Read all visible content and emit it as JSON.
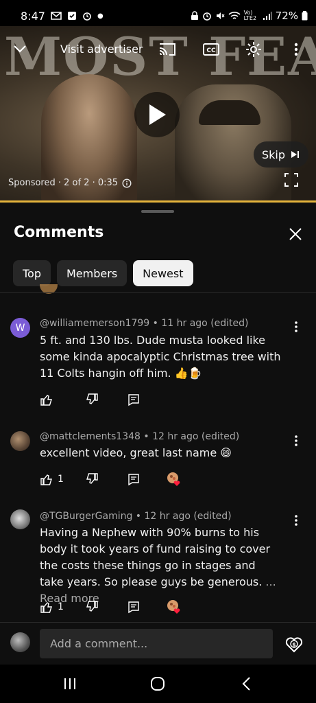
{
  "status_bar": {
    "time": "8:47",
    "left_icons": [
      "gmail-icon",
      "check-icon",
      "alarm-icon",
      "dot-icon"
    ],
    "right_icons": [
      "lock-icon",
      "alarm-icon",
      "mute-icon",
      "wifi-icon",
      "signal-icon"
    ],
    "network": "Vo) LTE2",
    "battery": "72%"
  },
  "video": {
    "background_title": "MOST FEARED",
    "visit_advertiser": "Visit advertiser",
    "skip_label": "Skip",
    "sponsored_text": "Sponsored · 2 of 2 · 0:35",
    "progress_fraction": 1.0,
    "accent_color": "#e5b43c"
  },
  "comments_panel": {
    "title": "Comments",
    "chips": [
      {
        "label": "Top",
        "active": false
      },
      {
        "label": "Members",
        "active": false
      },
      {
        "label": "Newest",
        "active": true
      }
    ],
    "comments": [
      {
        "avatar_letter": "W",
        "avatar_color": "#7b5cd6",
        "meta": "@williamemerson1799 • 11 hr ago (edited)",
        "text": "5 ft. and 130 lbs. Dude musta looked like some kinda apocalyptic Christmas tree with 11 Colts hangin off him. 👍🍺",
        "likes": "",
        "creator_heart": false
      },
      {
        "avatar_letter": "",
        "avatar_color": "#6b5a4a",
        "meta": "@mattclements1348 • 12 hr ago (edited)",
        "text": "excellent video, great last name 😄",
        "likes": "1",
        "creator_heart": true
      },
      {
        "avatar_letter": "",
        "avatar_color": "#8a8a8a",
        "meta": "@TGBurgerGaming • 12 hr ago (edited)",
        "text": "Having a Nephew with 90% burns to his body it took years of fund raising to cover the costs these things go in stages and take years. So please guys be generous.",
        "read_more": "... Read more",
        "likes": "1",
        "creator_heart": true
      }
    ],
    "add_comment_placeholder": "Add a comment..."
  },
  "nav_bar": {
    "buttons": [
      "recent-apps",
      "home",
      "back"
    ]
  }
}
